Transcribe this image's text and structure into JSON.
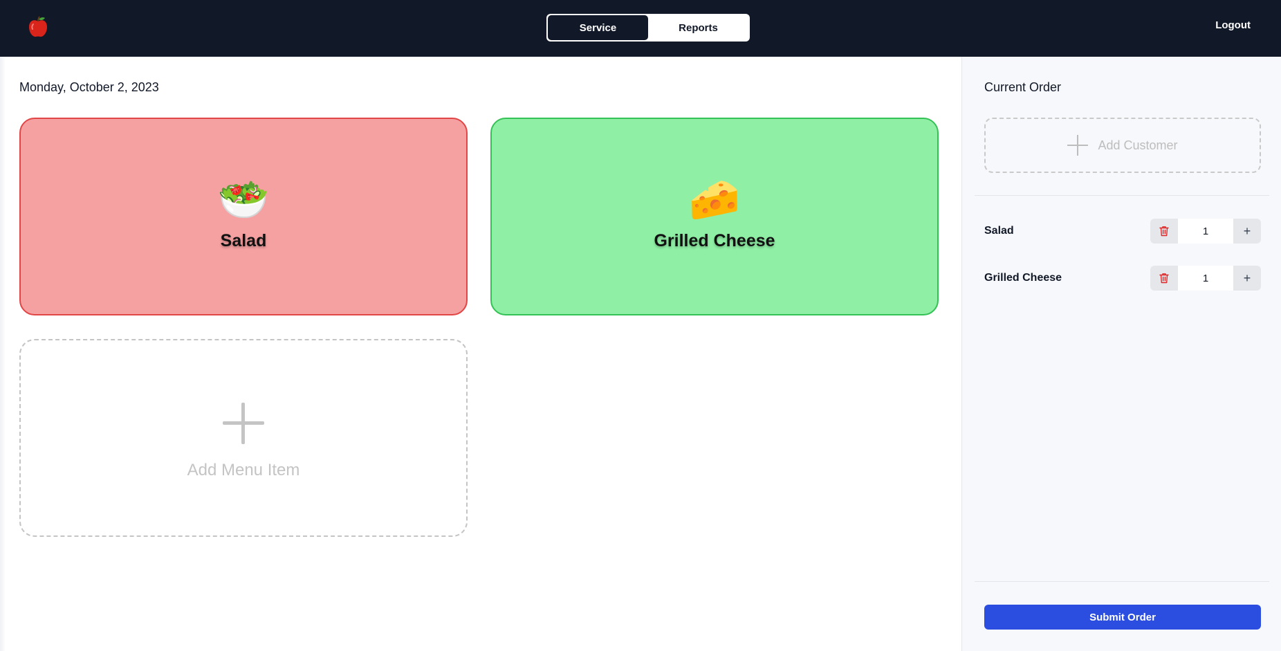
{
  "nav": {
    "logo_icon": "apple-icon",
    "tabs": [
      {
        "label": "Service",
        "active": true
      },
      {
        "label": "Reports",
        "active": false
      }
    ],
    "logout_label": "Logout"
  },
  "main": {
    "date": "Monday, October 2, 2023",
    "menu_items": [
      {
        "name": "Salad",
        "icon": "🥗",
        "color": "#f5a0a1",
        "border": "#e14545"
      },
      {
        "name": "Grilled Cheese",
        "icon": "🧀",
        "color": "#8fefa5",
        "border": "#34c155"
      }
    ],
    "add_item_label": "Add Menu Item"
  },
  "order": {
    "title": "Current Order",
    "add_customer_label": "Add Customer",
    "items": [
      {
        "name": "Salad",
        "qty": "1"
      },
      {
        "name": "Grilled Cheese",
        "qty": "1"
      }
    ],
    "submit_label": "Submit Order",
    "accent": "#2b4de0"
  }
}
